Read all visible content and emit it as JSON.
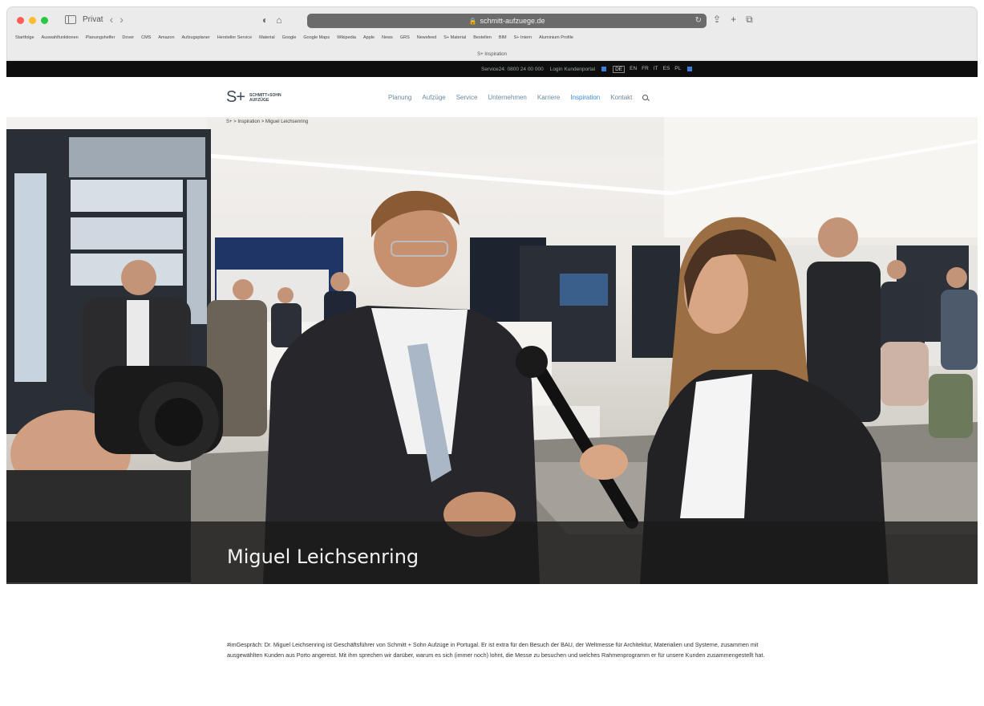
{
  "browser": {
    "url": "schmitt-aufzuege.de",
    "sidebar_label": "Privat",
    "bookmarks": [
      "Startfolge",
      "Auswahlfunktionen",
      "Planungshelfer",
      "Dover",
      "CMS",
      "Amazon",
      "Aufzugsplaner",
      "Hersteller Service",
      "Material",
      "Google",
      "Google Maps",
      "Wikipedia",
      "Apple",
      "News",
      "GRS",
      "Newsfeed",
      "S+ Material",
      "Bestellen",
      "BIM",
      "S+ Intern",
      "Aluminium Profile"
    ],
    "bookmark_subtitle": "S+ Inspiration"
  },
  "servicebar": {
    "service_text": "Service24: 0800 24 00 000",
    "login_text": "Login Kundenportal",
    "languages": [
      "DE",
      "EN",
      "FR",
      "IT",
      "ES",
      "PL"
    ]
  },
  "header": {
    "logo_mark": "S+",
    "logo_line1": "SCHMITT+SOHN",
    "logo_line2": "AUFZÜGE",
    "nav": [
      {
        "label": "Planung",
        "active": false
      },
      {
        "label": "Aufzüge",
        "active": false
      },
      {
        "label": "Service",
        "active": false
      },
      {
        "label": "Unternehmen",
        "active": false
      },
      {
        "label": "Karriere",
        "active": false
      },
      {
        "label": "Inspiration",
        "active": true
      },
      {
        "label": "Kontakt",
        "active": false
      }
    ]
  },
  "hero": {
    "breadcrumb": "S+ > Inspiration > Miguel Leichsenring",
    "title": "Miguel Leichsenring"
  },
  "content": {
    "paragraph": "#imGespräch: Dr. Miguel Leichsenring ist Geschäftsführer von Schmitt + Sohn Aufzüge in Portugal. Er ist extra für den Besuch der BAU, der Weltmesse für Architektur, Materialien und Systeme, zusammen mit ausgewählten Kunden aus Porto angereist. Mit ihm sprechen wir darüber, warum es sich (immer noch) lohnt, die Messe zu besuchen und welches Rahmenprogramm er für unsere Kunden zusammengestellt hat."
  },
  "colors": {
    "accent": "#3b8ed8",
    "nav_text": "#6b8aa0",
    "service_bar": "#0e0e0e"
  }
}
